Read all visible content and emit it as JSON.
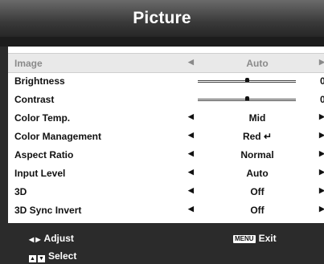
{
  "menu": {
    "title": "Picture"
  },
  "items": [
    {
      "label": "Image",
      "value": "Auto"
    },
    {
      "label": "Brightness",
      "value": "0",
      "slider": true
    },
    {
      "label": "Contrast",
      "value": "0",
      "slider": true
    },
    {
      "label": "Color Temp.",
      "value": "Mid"
    },
    {
      "label": "Color Management",
      "value": "Red ↵"
    },
    {
      "label": "Aspect Ratio",
      "value": "Normal"
    },
    {
      "label": "Input Level",
      "value": "Auto"
    },
    {
      "label": "3D",
      "value": "Off"
    },
    {
      "label": "3D Sync Invert",
      "value": "Off"
    }
  ],
  "footer": {
    "adjust_label": "Adjust",
    "menu_key": "MENU",
    "exit_label": "Exit",
    "select_label": "Select"
  },
  "colors": {
    "selected_row": "#e9e9e9",
    "panel": "#ffffff",
    "frame": "#2b2b2b"
  }
}
